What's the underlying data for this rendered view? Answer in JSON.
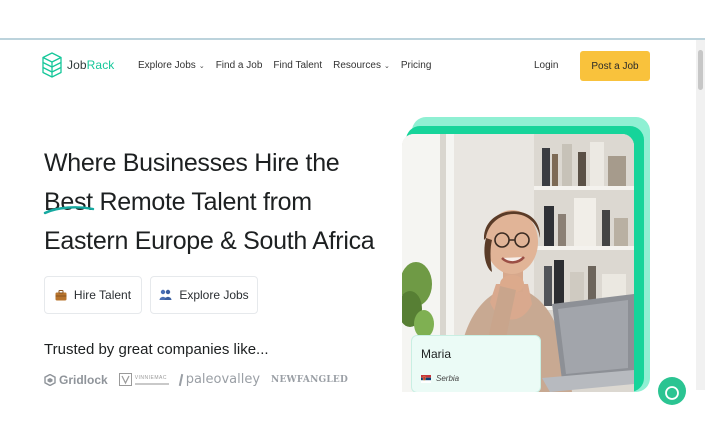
{
  "brand": {
    "name_part1": "Job",
    "name_part2": "Rack",
    "accent_color": "#16c79a"
  },
  "nav": {
    "items": [
      {
        "label": "Explore Jobs",
        "has_dropdown": true
      },
      {
        "label": "Find a Job",
        "has_dropdown": false
      },
      {
        "label": "Find Talent",
        "has_dropdown": false
      },
      {
        "label": "Resources",
        "has_dropdown": true
      },
      {
        "label": "Pricing",
        "has_dropdown": false
      }
    ],
    "login_label": "Login",
    "post_job_label": "Post a Job",
    "post_job_color": "#f9c23c"
  },
  "hero": {
    "title_line1": "Where Businesses Hire the",
    "title_line2_highlight": "Best",
    "title_line2_rest": " Remote Talent from",
    "title_line3": "Eastern Europe & South Africa",
    "buttons": {
      "hire_label": "Hire Talent",
      "explore_label": "Explore Jobs"
    },
    "trusted_label": "Trusted by great companies like..."
  },
  "company_logos": {
    "gridlock": "Gridlock",
    "vinnie_line1": "VINNIEMAC",
    "paleovalley": "paleovalley",
    "newfangled": "NEWFANGLED"
  },
  "profile_card": {
    "name": "Maria",
    "country": "Serbia"
  },
  "icons": {
    "logo": "cube-stack-icon",
    "hire": "briefcase-icon",
    "explore": "people-icon",
    "chevron": "chevron-down-icon",
    "flag": "serbia-flag-icon",
    "chat": "chat-bubble-icon"
  }
}
